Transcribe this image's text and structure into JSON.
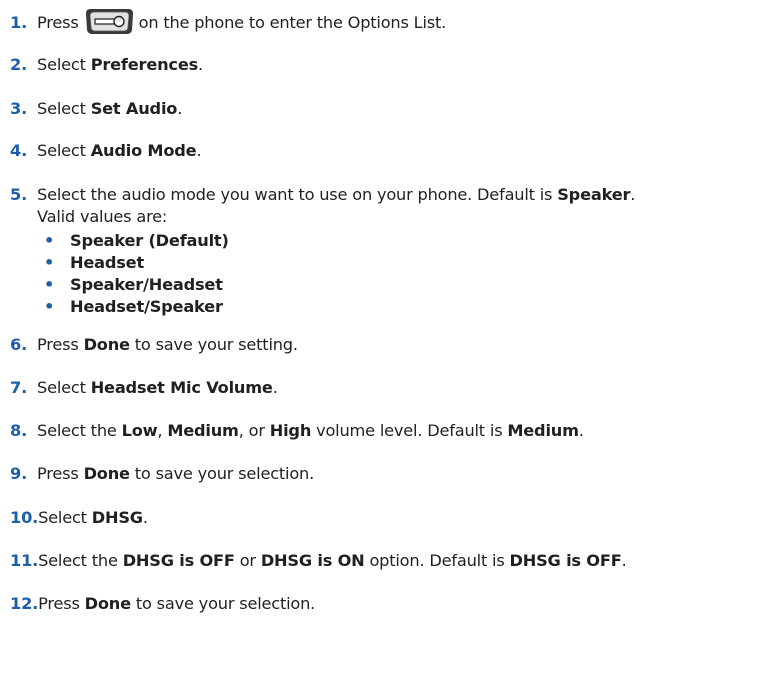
{
  "steps": [
    {
      "num": "1.",
      "pre": "Press",
      "post": "on the phone to enter the Options List."
    },
    {
      "num": "2.",
      "pre": "Select ",
      "bold": "Preferences",
      "post": "."
    },
    {
      "num": "3.",
      "pre": "Select ",
      "bold": "Set Audio",
      "post": "."
    },
    {
      "num": "4.",
      "pre": "Select ",
      "bold": "Audio Mode",
      "post": "."
    },
    {
      "num": "5.",
      "pre": "Select the audio mode you want to use on your phone. Default is ",
      "bold": "Speaker",
      "post": ".",
      "line2": "Valid values are:"
    },
    {
      "num": "6.",
      "pre": "Press ",
      "bold": "Done",
      "post": " to save your setting."
    },
    {
      "num": "7.",
      "pre": "Select ",
      "bold": "Headset Mic Volume",
      "post": "."
    },
    {
      "num": "8.",
      "pre": "Select the ",
      "bold": "Low",
      "mid1": ", ",
      "bold2": "Medium",
      "mid2": ", or ",
      "bold3": "High",
      "mid3": " volume level. Default is ",
      "bold4": "Medium",
      "post": "."
    },
    {
      "num": "9.",
      "pre": "Press ",
      "bold": "Done",
      "post": " to save your selection."
    },
    {
      "num": "10.",
      "pre": "Select ",
      "bold": "DHSG",
      "post": "."
    },
    {
      "num": "11.",
      "pre": "Select the ",
      "bold": "DHSG is OFF",
      "mid1": " or ",
      "bold2": "DHSG is ON",
      "mid2": " option. Default is ",
      "bold3": "DHSG is OFF",
      "post": "."
    },
    {
      "num": "12.",
      "pre": "Press ",
      "bold": "Done",
      "post": " to save your selection."
    }
  ],
  "audio_modes": [
    "Speaker (Default)",
    "Headset",
    "Speaker/Headset",
    "Headset/Speaker"
  ],
  "bullet_char": "•",
  "icons": {
    "options_key": "options-key-icon"
  },
  "colors": {
    "number": "#1f5fa8",
    "text": "#231f20"
  }
}
